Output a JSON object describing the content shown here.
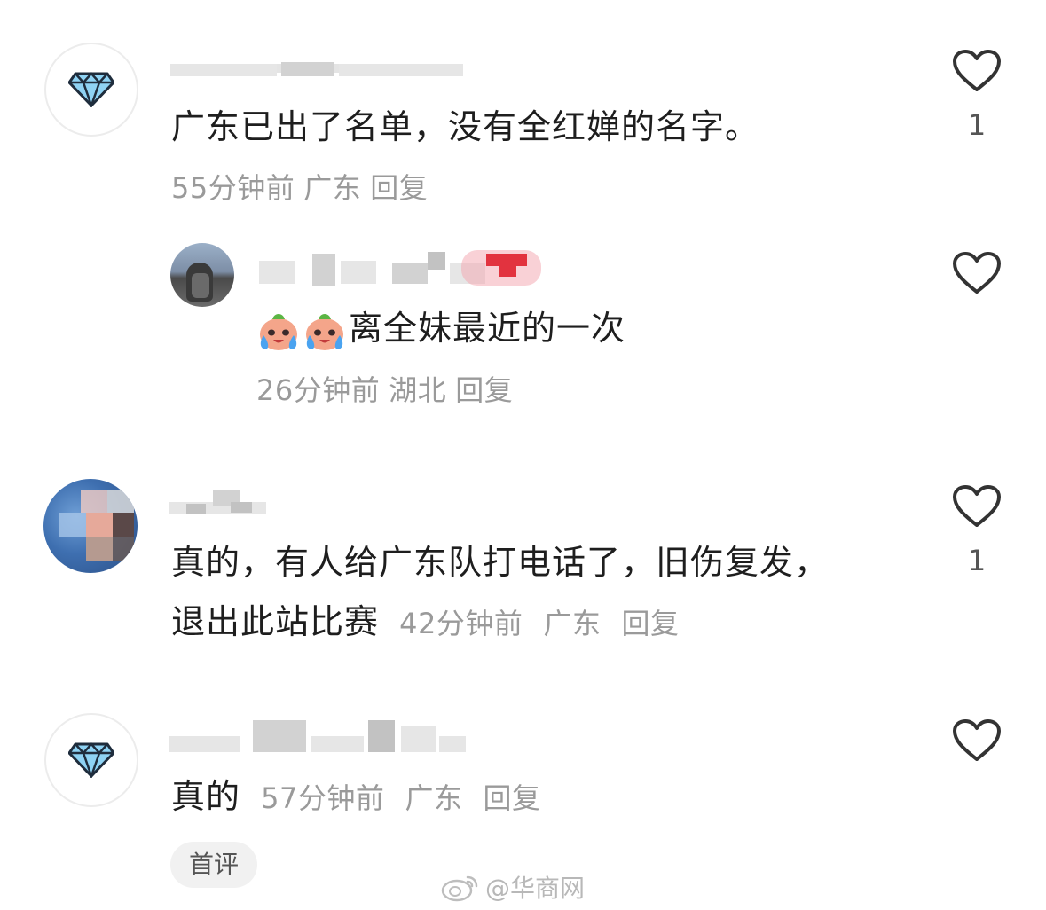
{
  "colors": {
    "text": "#1e1e1e",
    "meta": "#9a9a9a",
    "icon": "#333333",
    "pill_bg": "#f1f1f1"
  },
  "comments": [
    {
      "avatar": "diamond-icon",
      "text": "广东已出了名单，没有全红婵的名字。",
      "time": "55分钟前",
      "location": "广东",
      "reply": "回复",
      "likes": "1",
      "replies": [
        {
          "avatar": "photo",
          "emojis": [
            "crying-face-emoji",
            "crying-face-emoji"
          ],
          "text": "离全妹最近的一次",
          "time": "26分钟前",
          "location": "湖北",
          "reply": "回复"
        }
      ]
    },
    {
      "avatar": "photo",
      "text_line1": "真的，有人给广东队打电话了，旧伤复发，",
      "text_line2": "退出此站比赛",
      "time": "42分钟前",
      "location": "广东",
      "reply": "回复",
      "likes": "1"
    },
    {
      "avatar": "diamond-icon",
      "text": "真的",
      "time": "57分钟前",
      "location": "广东",
      "reply": "回复"
    }
  ],
  "first_comment_tag": "首评",
  "watermark": "@华商网"
}
